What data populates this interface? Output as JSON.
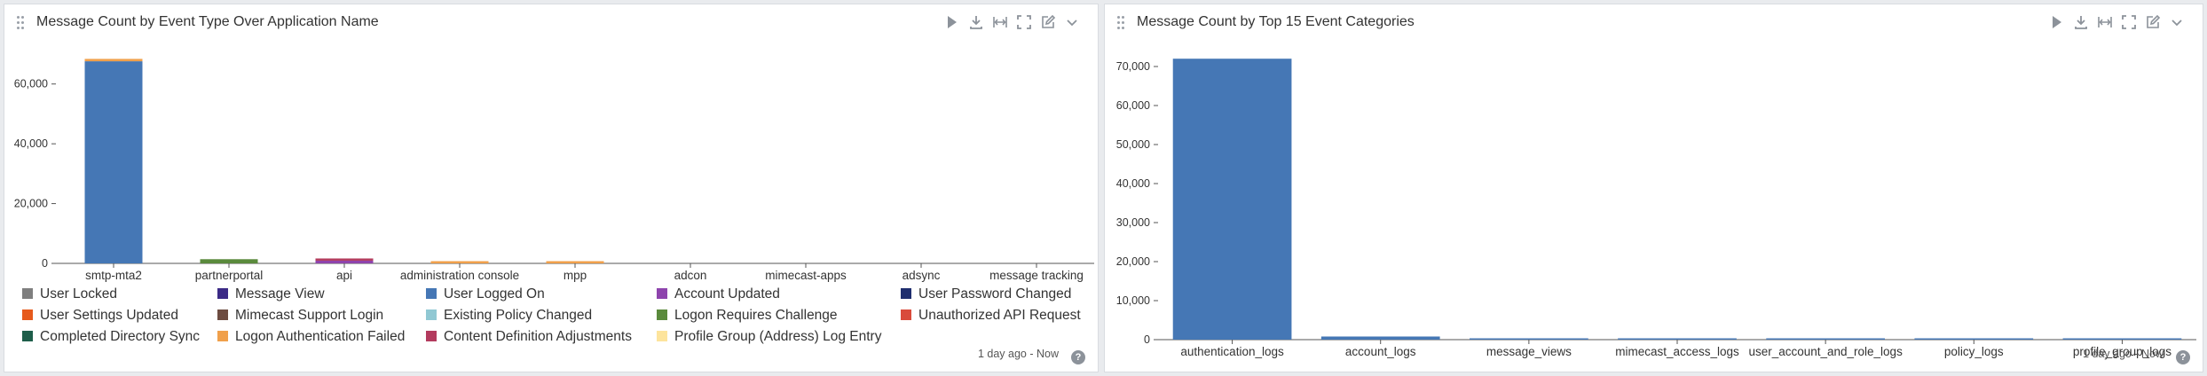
{
  "panels": [
    {
      "title": "Message Count by Event Type Over Application Name",
      "time_range": "1 day ago - Now",
      "help_symbol": "?"
    },
    {
      "title": "Message Count by Top 15 Event Categories",
      "time_range": "1 day ago - Now",
      "help_symbol": "?"
    }
  ],
  "toolbar_icons": [
    "play-icon",
    "download-icon",
    "fit-width-icon",
    "fullscreen-icon",
    "edit-icon",
    "chevron-down-icon"
  ],
  "colors": {
    "bar_blue": "#4577b5",
    "gridline": "#e6e8ec",
    "axis": "#555555"
  },
  "chart_data": [
    {
      "type": "bar",
      "stacked": true,
      "title": "Message Count by Event Type Over Application Name",
      "categories": [
        "smtp-mta2",
        "partnerportal",
        "api",
        "administration console",
        "mpp",
        "adcon",
        "mimecast-apps",
        "adsync",
        "message tracking"
      ],
      "ylim": [
        0,
        70000
      ],
      "yticks": [
        0,
        20000,
        40000,
        60000
      ],
      "ytick_labels": [
        "0",
        "20,000",
        "40,000",
        "60,000"
      ],
      "grid": false,
      "legend_position": "bottom",
      "series": [
        {
          "name": "User Locked",
          "color": "#7f7f7f",
          "values": [
            0,
            0,
            0,
            0,
            0,
            0,
            0,
            0,
            0
          ]
        },
        {
          "name": "Message View",
          "color": "#3b2a86",
          "values": [
            0,
            0,
            0,
            0,
            0,
            0,
            0,
            0,
            0
          ]
        },
        {
          "name": "User Logged On",
          "color": "#4577b5",
          "values": [
            67600,
            0,
            0,
            0,
            0,
            0,
            0,
            0,
            0
          ]
        },
        {
          "name": "Account Updated",
          "color": "#8e44ad",
          "values": [
            0,
            0,
            900,
            0,
            0,
            0,
            0,
            0,
            0
          ]
        },
        {
          "name": "User Password Changed",
          "color": "#1f2e6e",
          "values": [
            0,
            0,
            0,
            0,
            0,
            0,
            0,
            0,
            0
          ]
        },
        {
          "name": "User Settings Updated",
          "color": "#e65a1c",
          "values": [
            0,
            0,
            0,
            0,
            0,
            0,
            0,
            0,
            0
          ]
        },
        {
          "name": "Mimecast Support Login",
          "color": "#6d4c41",
          "values": [
            0,
            0,
            0,
            0,
            0,
            0,
            0,
            0,
            0
          ]
        },
        {
          "name": "Existing Policy Changed",
          "color": "#90c8d3",
          "values": [
            0,
            0,
            0,
            0,
            0,
            0,
            0,
            0,
            0
          ]
        },
        {
          "name": "Logon Requires Challenge",
          "color": "#5a8a3c",
          "values": [
            0,
            1400,
            0,
            0,
            0,
            0,
            0,
            0,
            0
          ]
        },
        {
          "name": "Unauthorized API Request",
          "color": "#d94b3b",
          "values": [
            0,
            0,
            0,
            0,
            0,
            0,
            0,
            0,
            0
          ]
        },
        {
          "name": "Completed Directory Sync",
          "color": "#1e5e4a",
          "values": [
            0,
            0,
            0,
            0,
            0,
            0,
            0,
            0,
            0
          ]
        },
        {
          "name": "Logon Authentication Failed",
          "color": "#f0a04b",
          "values": [
            800,
            0,
            0,
            300,
            250,
            0,
            0,
            0,
            0
          ]
        },
        {
          "name": "Content Definition Adjustments",
          "color": "#b33b5e",
          "values": [
            0,
            0,
            500,
            0,
            0,
            0,
            0,
            0,
            0
          ]
        },
        {
          "name": "Profile Group (Address) Log Entry",
          "color": "#fde49c",
          "values": [
            0,
            0,
            0,
            0,
            0,
            0,
            0,
            0,
            0
          ]
        }
      ]
    },
    {
      "type": "bar",
      "title": "Message Count by Top 15 Event Categories",
      "categories": [
        "authentication_logs",
        "account_logs",
        "message_views",
        "mimecast_access_logs",
        "user_account_and_role_logs",
        "policy_logs",
        "profile_group_logs"
      ],
      "values": [
        72000,
        800,
        80,
        60,
        40,
        30,
        20
      ],
      "ylim": [
        0,
        75000
      ],
      "yticks": [
        0,
        10000,
        20000,
        30000,
        40000,
        50000,
        60000,
        70000
      ],
      "ytick_labels": [
        "0",
        "10,000",
        "20,000",
        "30,000",
        "40,000",
        "50,000",
        "60,000",
        "70,000"
      ],
      "grid": false,
      "color": "#4577b5"
    }
  ]
}
